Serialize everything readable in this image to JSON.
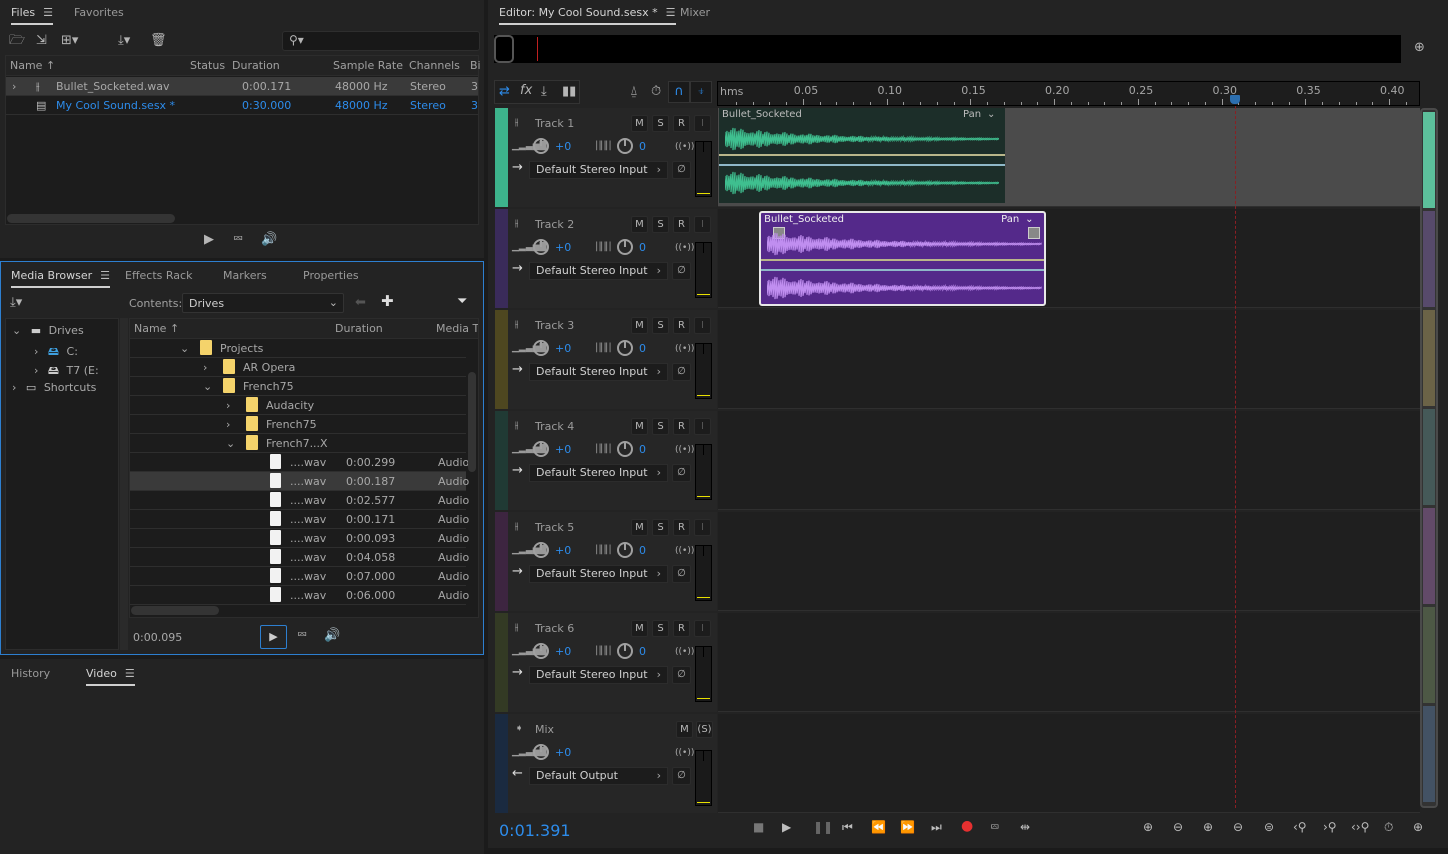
{
  "files_panel": {
    "tabs": [
      {
        "label": "Files",
        "active": true
      },
      {
        "label": "Favorites",
        "active": false
      }
    ],
    "toolbar_icons": [
      "open-file-icon",
      "import-icon",
      "new-file-icon",
      "insert-into-multitrack-icon",
      "delete-icon"
    ],
    "search_placeholder": "",
    "columns": [
      "Name",
      "Status",
      "Duration",
      "Sample Rate",
      "Channels",
      "Bi"
    ],
    "sort_indicator": "↑",
    "rows": [
      {
        "name": "Bullet_Socketed.wav",
        "status": "",
        "duration": "0:00.171",
        "sample_rate": "48000 Hz",
        "channels": "Stereo",
        "bits": "3",
        "selected": true,
        "type": "waveform"
      },
      {
        "name": "My Cool Sound.sesx *",
        "status": "",
        "duration": "0:30.000",
        "sample_rate": "48000 Hz",
        "channels": "Stereo",
        "bits": "3",
        "selected": false,
        "highlight": true,
        "type": "multitrack"
      }
    ],
    "transport_icons": [
      "play-icon",
      "loop-icon",
      "autoplay-icon"
    ]
  },
  "media_browser": {
    "tabs": [
      {
        "label": "Media Browser",
        "active": true
      },
      {
        "label": "Effects Rack",
        "active": false
      },
      {
        "label": "Markers",
        "active": false
      },
      {
        "label": "Properties",
        "active": false
      }
    ],
    "contents_label": "Contents:",
    "contents_value": "Drives",
    "tree": [
      {
        "label": "Drives",
        "expanded": true,
        "level": 0
      },
      {
        "label": "C:",
        "expanded": false,
        "level": 1
      },
      {
        "label": "T7 (E:",
        "expanded": false,
        "level": 1
      },
      {
        "label": "Shortcuts",
        "expanded": false,
        "level": 0
      }
    ],
    "columns": [
      "Name",
      "Duration",
      "Media Ty"
    ],
    "rows": [
      {
        "name": "Projects",
        "duration": "",
        "type": "",
        "kind": "folder",
        "level": 0,
        "expanded": true
      },
      {
        "name": "AR Opera",
        "duration": "",
        "type": "",
        "kind": "folder",
        "level": 1,
        "expanded": false
      },
      {
        "name": "French75",
        "duration": "",
        "type": "",
        "kind": "folder",
        "level": 1,
        "expanded": true
      },
      {
        "name": "Audacity",
        "duration": "",
        "type": "",
        "kind": "folder",
        "level": 2,
        "expanded": false
      },
      {
        "name": "French75",
        "duration": "",
        "type": "",
        "kind": "folder",
        "level": 2,
        "expanded": false
      },
      {
        "name": "French7...X",
        "duration": "",
        "type": "",
        "kind": "folder",
        "level": 2,
        "expanded": true
      },
      {
        "name": "....wav",
        "duration": "0:00.299",
        "type": "Audio",
        "kind": "file",
        "level": 3
      },
      {
        "name": "....wav",
        "duration": "0:00.187",
        "type": "Audio",
        "kind": "file",
        "level": 3,
        "selected": true
      },
      {
        "name": "....wav",
        "duration": "0:02.577",
        "type": "Audio",
        "kind": "file",
        "level": 3
      },
      {
        "name": "....wav",
        "duration": "0:00.171",
        "type": "Audio",
        "kind": "file",
        "level": 3
      },
      {
        "name": "....wav",
        "duration": "0:00.093",
        "type": "Audio",
        "kind": "file",
        "level": 3
      },
      {
        "name": "....wav",
        "duration": "0:04.058",
        "type": "Audio",
        "kind": "file",
        "level": 3
      },
      {
        "name": "....wav",
        "duration": "0:07.000",
        "type": "Audio",
        "kind": "file",
        "level": 3
      },
      {
        "name": "....wav",
        "duration": "0:06.000",
        "type": "Audio",
        "kind": "file",
        "level": 3
      }
    ],
    "preview_time": "0:00.095"
  },
  "bottom_panel": {
    "tabs": [
      {
        "label": "History",
        "active": false
      },
      {
        "label": "Video",
        "active": true
      }
    ]
  },
  "editor": {
    "tabs": [
      {
        "label": "Editor: My Cool Sound.sesx *",
        "active": true
      },
      {
        "label": "Mixer",
        "active": false
      }
    ],
    "ruler_unit": "hms",
    "ruler_labels": [
      "0.05",
      "0.10",
      "0.15",
      "0.20",
      "0.25",
      "0.30",
      "0.35",
      "0.40"
    ],
    "playhead_time_s": 0.308,
    "tracks": [
      {
        "name": "Track 1",
        "color": "#3db38c",
        "volume": "+0",
        "pan": "0",
        "input": "Default Stereo Input",
        "buttons": [
          "M",
          "S",
          "R",
          "I"
        ],
        "clip": {
          "title": "Bullet_Socketed",
          "pan_label": "Pan",
          "bg": "#1c2e29",
          "wave": "#3fbf8f",
          "start_s": 0.0,
          "end_s": 0.171,
          "selected": false
        }
      },
      {
        "name": "Track 2",
        "color": "#3a2b5a",
        "volume": "+0",
        "pan": "0",
        "input": "Default Stereo Input",
        "buttons": [
          "M",
          "S",
          "R",
          "I"
        ],
        "clip": {
          "title": "Bullet_Socketed",
          "pan_label": "Pan",
          "bg": "#54298a",
          "wave": "#c08ef0",
          "start_s": 0.018,
          "end_s": 0.189,
          "selected": true
        }
      },
      {
        "name": "Track 3",
        "color": "#4e4720",
        "volume": "+0",
        "pan": "0",
        "input": "Default Stereo Input",
        "buttons": [
          "M",
          "S",
          "R",
          "I"
        ]
      },
      {
        "name": "Track 4",
        "color": "#203a34",
        "volume": "+0",
        "pan": "0",
        "input": "Default Stereo Input",
        "buttons": [
          "M",
          "S",
          "R",
          "I"
        ]
      },
      {
        "name": "Track 5",
        "color": "#3d2540",
        "volume": "+0",
        "pan": "0",
        "input": "Default Stereo Input",
        "buttons": [
          "M",
          "S",
          "R",
          "I"
        ]
      },
      {
        "name": "Track 6",
        "color": "#333a24",
        "volume": "+0",
        "pan": "0",
        "input": "Default Stereo Input",
        "buttons": [
          "M",
          "S",
          "R",
          "I"
        ]
      }
    ],
    "mix": {
      "name": "Mix",
      "color": "#1a2a40",
      "volume": "+0",
      "output": "Default Output",
      "buttons": [
        "M",
        "(S)"
      ]
    },
    "navigator_colors": [
      "#5cbf9b",
      "#574a6b",
      "#6b6347",
      "#455958",
      "#624a68",
      "#4d5845",
      "#435264"
    ],
    "current_time": "0:01.391",
    "transport_icons": [
      "stop-icon",
      "play-icon",
      "pause-icon",
      "go-to-start-icon",
      "rewind-icon",
      "fast-forward-icon",
      "go-to-end-icon",
      "record-icon",
      "loop-icon",
      "skip-selection-icon"
    ],
    "zoom_icons": [
      "zoom-in-amplitude-icon",
      "zoom-out-amplitude-icon",
      "zoom-in-time-icon",
      "zoom-out-time-icon",
      "zoom-out-full-icon",
      "zoom-in-selection-start-icon",
      "zoom-in-selection-end-icon",
      "zoom-to-selection-icon",
      "zoom-to-time-icon",
      "zoom-in-tracks-icon"
    ]
  }
}
